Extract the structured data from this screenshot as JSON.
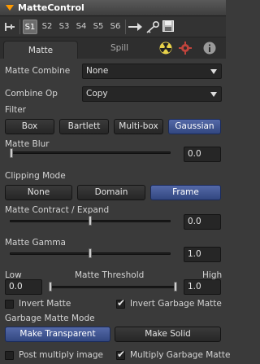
{
  "window": {
    "title": "MatteControl"
  },
  "toolbar": {
    "slots": [
      "S1",
      "S2",
      "S3",
      "S4",
      "S5",
      "S6"
    ],
    "active_slot": "S1"
  },
  "tabs": {
    "matte": "Matte",
    "spill": "Spill"
  },
  "matte_combine": {
    "label": "Matte Combine",
    "value": "None"
  },
  "combine_op": {
    "label": "Combine Op",
    "value": "Copy"
  },
  "filter": {
    "label": "Filter",
    "options": [
      "Box",
      "Bartlett",
      "Multi-box",
      "Gaussian"
    ],
    "selected": "Gaussian"
  },
  "matte_blur": {
    "label": "Matte Blur",
    "value": "0.0",
    "level": 0.0
  },
  "clipping_mode": {
    "label": "Clipping Mode",
    "options": [
      "None",
      "Domain",
      "Frame"
    ],
    "selected": "Frame"
  },
  "matte_contract_expand": {
    "label": "Matte Contract / Expand",
    "value": "0.0",
    "level": 0.5
  },
  "matte_gamma": {
    "label": "Matte Gamma",
    "value": "1.0",
    "level": 0.5
  },
  "matte_threshold": {
    "label": "Matte Threshold",
    "low_label": "Low",
    "high_label": "High",
    "low_value": "0.0",
    "high_value": "1.0"
  },
  "invert_matte": {
    "label": "Invert Matte",
    "checked": false
  },
  "invert_garbage_matte": {
    "label": "Invert Garbage Matte",
    "checked": true
  },
  "garbage_matte_mode": {
    "label": "Garbage Matte Mode",
    "options": [
      "Make Transparent",
      "Make Solid"
    ],
    "selected": "Make Transparent"
  },
  "post_multiply_image": {
    "label": "Post multiply image",
    "checked": false
  },
  "multiply_garbage_matte": {
    "label": "Multiply Garbage Matte",
    "checked": true
  },
  "colors": {
    "title_accent": "#ff9a00",
    "selected_button": "#3f5592",
    "panel_bg": "#3a3a3a"
  }
}
